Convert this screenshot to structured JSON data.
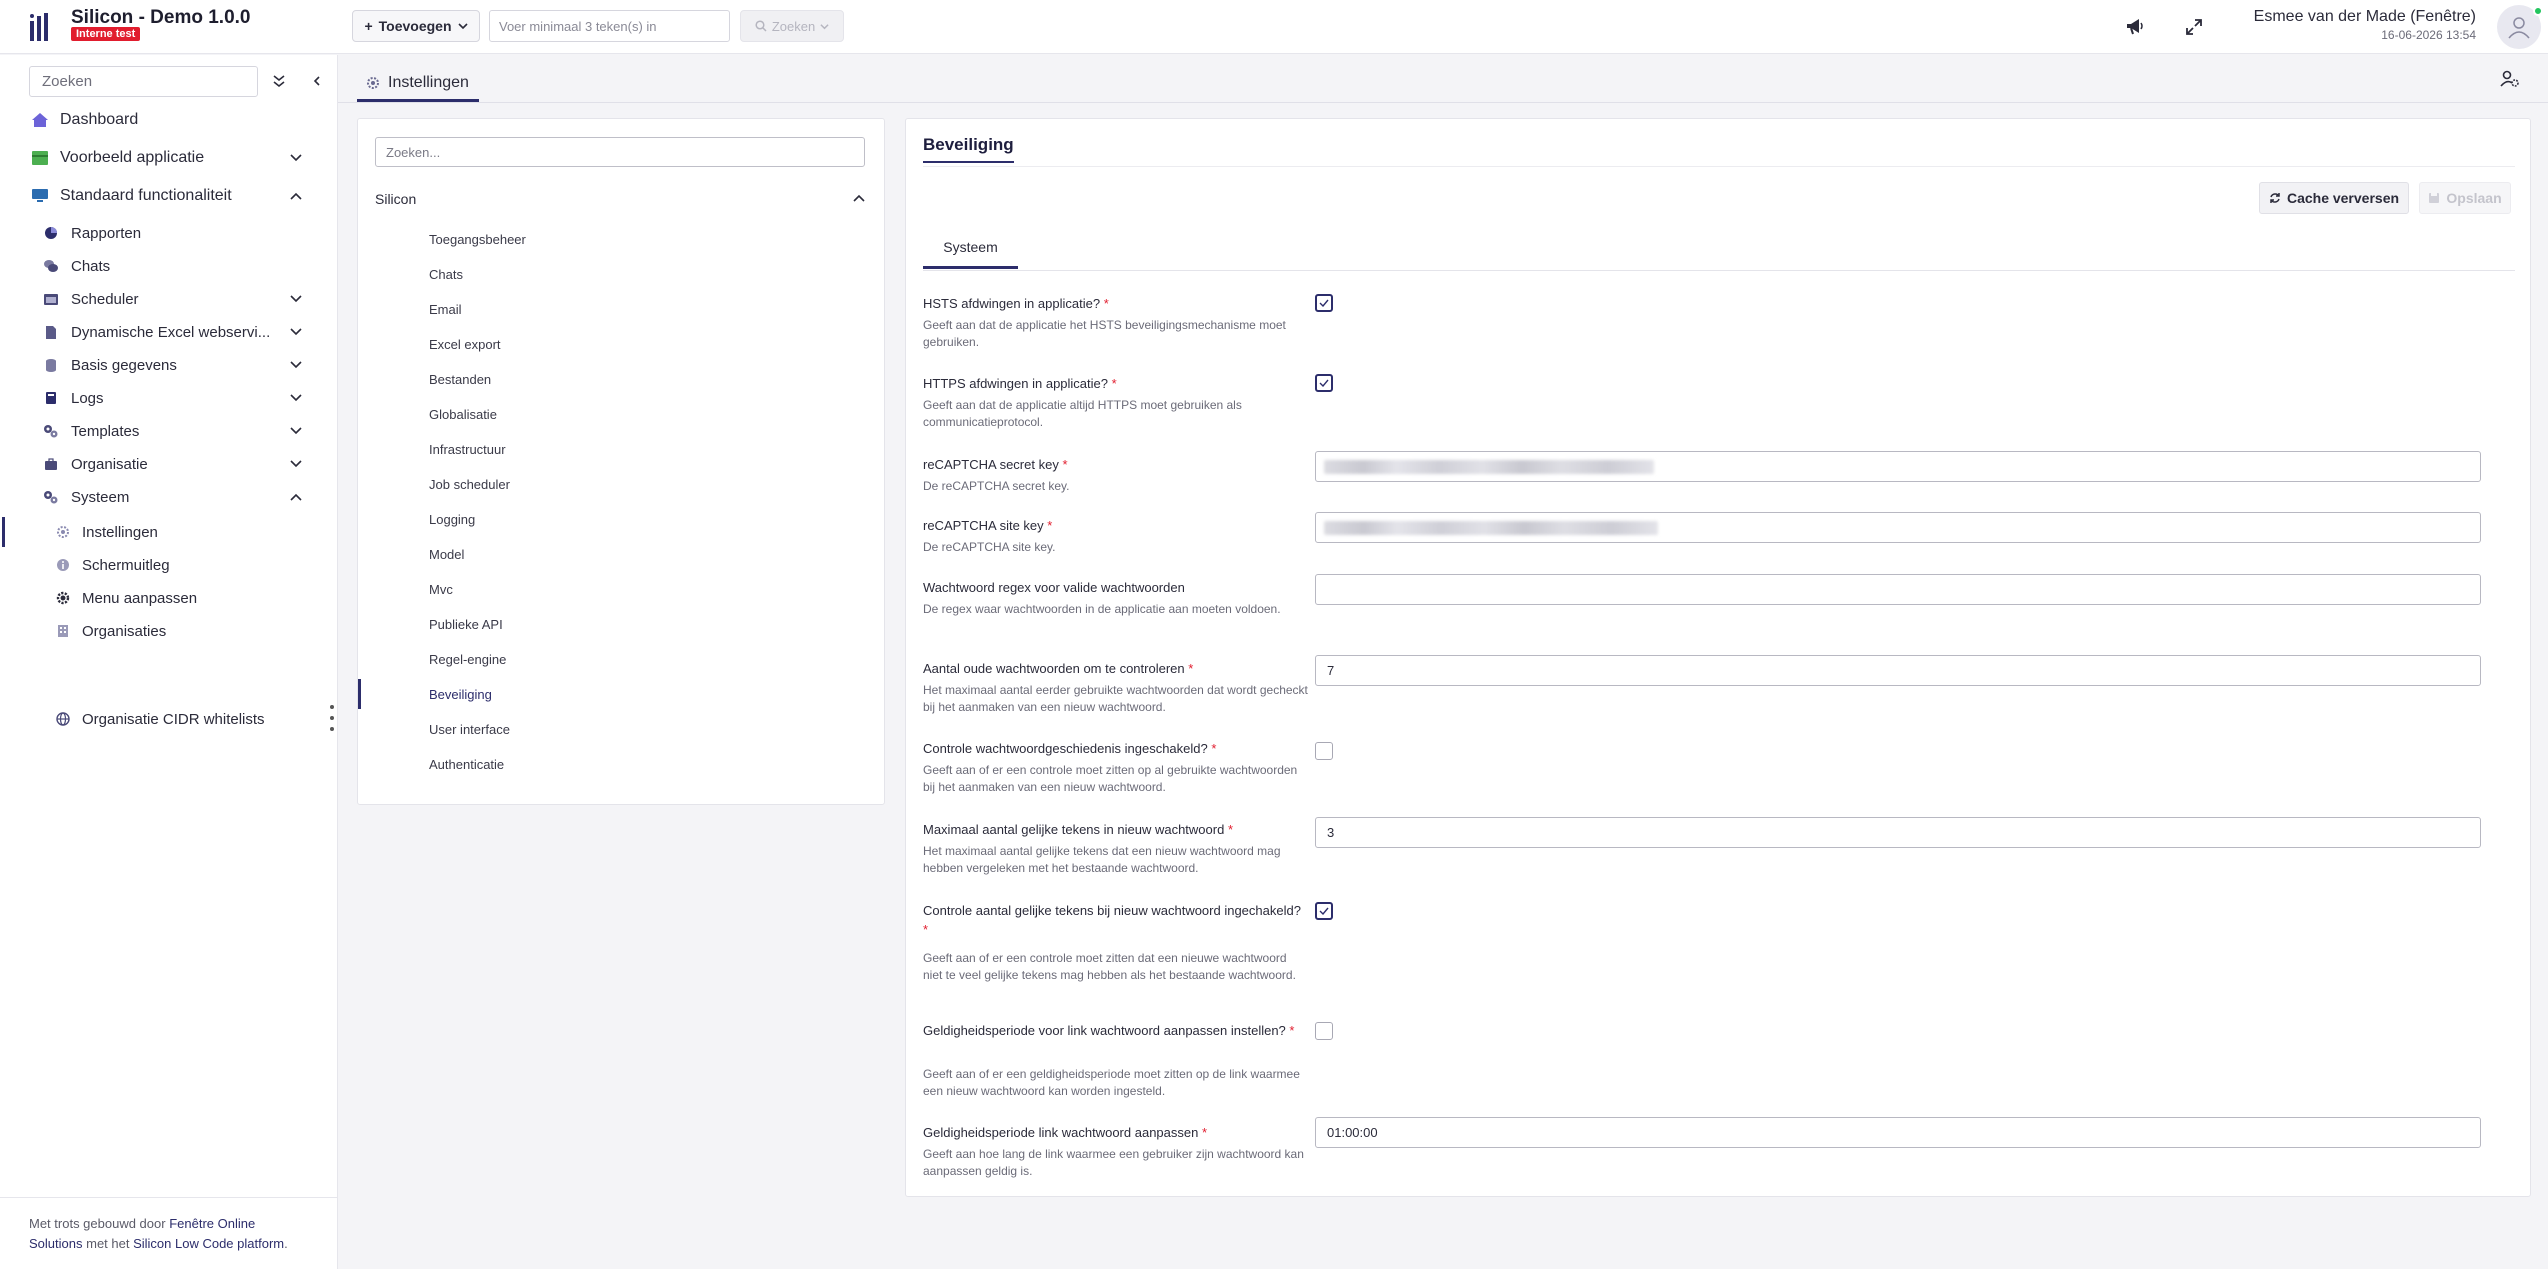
{
  "app": {
    "title": "Silicon - Demo 1.0.0",
    "env_badge": "Interne test",
    "accent": "#2c2d6b",
    "badge_color": "#e11d2e"
  },
  "topbar": {
    "add_label": "Toevoegen",
    "search_placeholder": "Voer minimaal 3 teken(s) in",
    "search_button": "Zoeken",
    "user_name": "Esmee van der Made (Fenêtre)",
    "user_date": "16-06-2026 13:54"
  },
  "sidebar": {
    "search_placeholder": "Zoeken",
    "items": [
      {
        "label": "Dashboard",
        "icon": "home-icon"
      },
      {
        "label": "Voorbeeld applicatie",
        "icon": "table-icon"
      },
      {
        "label": "Standaard functionaliteit",
        "icon": "monitor-icon"
      },
      {
        "label": "Rapporten",
        "icon": "pie-chart-icon"
      },
      {
        "label": "Chats",
        "icon": "chat-icon"
      },
      {
        "label": "Scheduler",
        "icon": "calendar-icon"
      },
      {
        "label": "Dynamische Excel webservi...",
        "icon": "file-icon"
      },
      {
        "label": "Basis gegevens",
        "icon": "database-icon"
      },
      {
        "label": "Logs",
        "icon": "book-icon"
      },
      {
        "label": "Templates",
        "icon": "gears-icon"
      },
      {
        "label": "Organisatie",
        "icon": "briefcase-icon"
      },
      {
        "label": "Systeem",
        "icon": "gears-icon"
      },
      {
        "label": "Instellingen",
        "icon": "gear-icon"
      },
      {
        "label": "Schermuitleg",
        "icon": "info-icon"
      },
      {
        "label": "Menu aanpassen",
        "icon": "cog-icon"
      },
      {
        "label": "Organisaties",
        "icon": "building-icon"
      },
      {
        "label": "Organisatie CIDR whitelists",
        "icon": "globe-icon"
      }
    ],
    "footer_prefix": "Met trots gebouwd door",
    "footer_company": "Fenêtre Online Solutions",
    "footer_mid": "met het",
    "footer_platform": "Silicon Low Code platform",
    "footer_end": "."
  },
  "page_tab": {
    "label": "Instellingen"
  },
  "left_panel": {
    "search_placeholder": "Zoeken...",
    "group": "Silicon",
    "items": [
      "Toegangsbeheer",
      "Chats",
      "Email",
      "Excel export",
      "Bestanden",
      "Globalisatie",
      "Infrastructuur",
      "Job scheduler",
      "Logging",
      "Model",
      "Mvc",
      "Publieke API",
      "Regel-engine",
      "Beveiliging",
      "User interface",
      "Authenticatie"
    ],
    "active": "Beveiliging"
  },
  "right_panel": {
    "title": "Beveiliging",
    "cache_button": "Cache verversen",
    "save_button": "Opslaan",
    "subtab": "Systeem",
    "fields": [
      {
        "label": "HSTS afdwingen in applicatie?",
        "req": "*",
        "desc": "Geeft aan dat de applicatie het HSTS beveiligingsmechanisme moet gebruiken.",
        "type": "checkbox",
        "checked": true
      },
      {
        "label": "HTTPS afdwingen in applicatie?",
        "req": "*",
        "desc": "Geeft aan dat de applicatie altijd HTTPS moet gebruiken als communicatieprotocol.",
        "type": "checkbox",
        "checked": true
      },
      {
        "label": "reCAPTCHA secret key",
        "req": "*",
        "desc": "De reCAPTCHA secret key.",
        "type": "masked"
      },
      {
        "label": "reCAPTCHA site key",
        "req": "*",
        "desc": "De reCAPTCHA site key.",
        "type": "masked"
      },
      {
        "label": "Wachtwoord regex voor valide wachtwoorden",
        "req": "",
        "desc": "De regex waar wachtwoorden in de applicatie aan moeten voldoen.",
        "type": "text",
        "value": ""
      },
      {
        "label": "Aantal oude wachtwoorden om te controleren",
        "req": "*",
        "desc": "Het maximaal aantal eerder gebruikte wachtwoorden dat wordt gecheckt bij het aanmaken van een nieuw wachtwoord.",
        "type": "text",
        "value": "7"
      },
      {
        "label": "Controle wachtwoordgeschiedenis ingeschakeld?",
        "req": "*",
        "desc": "Geeft aan of er een controle moet zitten op al gebruikte wachtwoorden bij het aanmaken van een nieuw wachtwoord.",
        "type": "checkbox",
        "checked": false
      },
      {
        "label": "Maximaal aantal gelijke tekens in nieuw wachtwoord",
        "req": "*",
        "desc": "Het maximaal aantal gelijke tekens dat een nieuw wachtwoord mag hebben vergeleken met het bestaande wachtwoord.",
        "type": "text",
        "value": "3"
      },
      {
        "label": "Controle aantal gelijke tekens bij nieuw wachtwoord ingechakeld?",
        "req": "*",
        "desc": "Geeft aan of er een controle moet zitten dat een nieuwe wachtwoord niet te veel gelijke tekens mag hebben als het bestaande wachtwoord.",
        "type": "checkbox",
        "checked": true
      },
      {
        "label": "Geldigheidsperiode voor link wachtwoord aanpassen instellen?",
        "req": "*",
        "desc": "Geeft aan of er een geldigheidsperiode moet zitten op de link waarmee een nieuw wachtwoord kan worden ingesteld.",
        "type": "checkbox",
        "checked": false
      },
      {
        "label": "Geldigheidsperiode link wachtwoord aanpassen",
        "req": "*",
        "desc": "Geeft aan hoe lang de link waarmee een gebruiker zijn wachtwoord kan aanpassen geldig is.",
        "type": "text",
        "value": "01:00:00"
      }
    ]
  }
}
